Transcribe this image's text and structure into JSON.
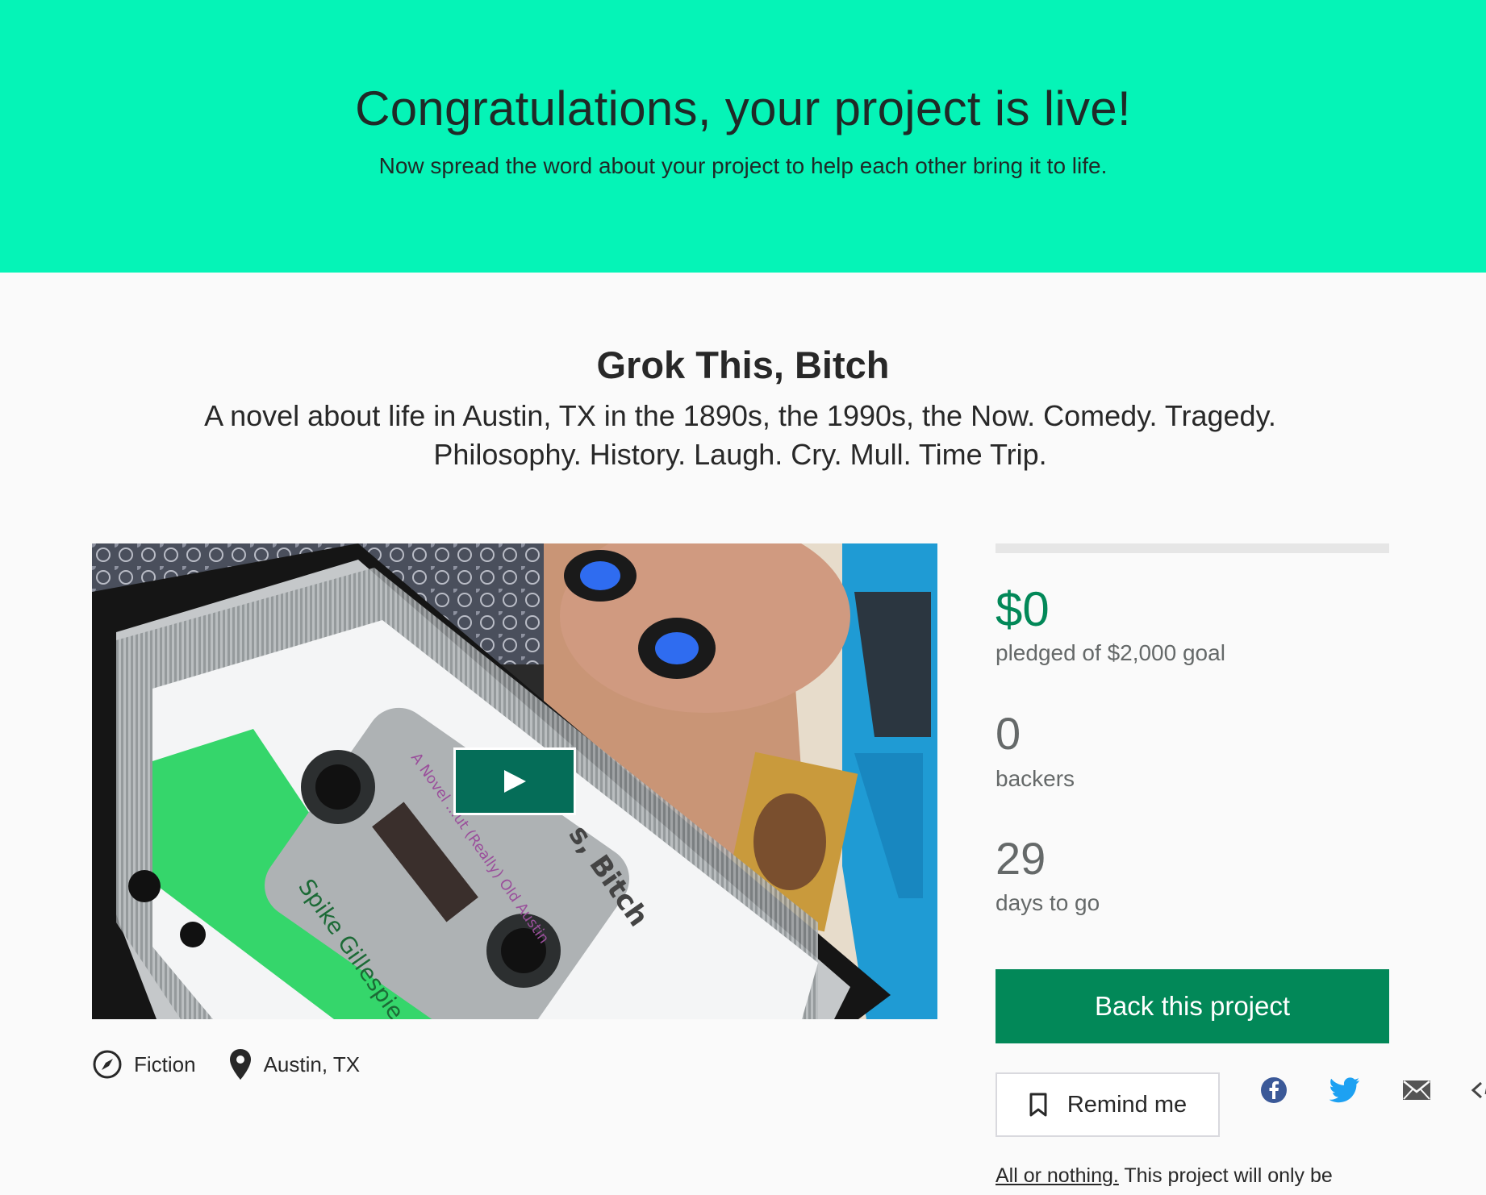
{
  "banner": {
    "title": "Congratulations, your project is live!",
    "subtitle": "Now spread the word about your project to help each other bring it to life."
  },
  "project": {
    "title": "Grok This, Bitch",
    "blurb": "A novel about life in Austin, TX in the 1890s, the 1990s, the Now. Comedy. Tragedy. Philosophy. History. Laugh. Cry. Mull. Time Trip.",
    "category": "Fiction",
    "location": "Austin, TX",
    "video_art": {
      "cassette_title": "s, Bitch",
      "cassette_subtitle": "A Novel ...ut (Really) Old Austin",
      "cassette_author": "Spike Gillespie"
    }
  },
  "stats": {
    "funded_fraction": 0,
    "pledged": "$0",
    "pledged_label": "pledged of $2,000 goal",
    "backers": "0",
    "backers_label": "backers",
    "days": "29",
    "days_label": "days to go"
  },
  "actions": {
    "back_label": "Back this project",
    "remind_label": "Remind me",
    "share": [
      "facebook-icon",
      "twitter-icon",
      "email-icon",
      "embed-icon"
    ]
  },
  "funding_note": {
    "link": "All or nothing.",
    "text": " This project will only be"
  },
  "colors": {
    "banner": "#05f4b7",
    "accent": "#028858",
    "play_button": "#056d58",
    "facebook": "#3b5998",
    "twitter": "#1da1f2"
  }
}
